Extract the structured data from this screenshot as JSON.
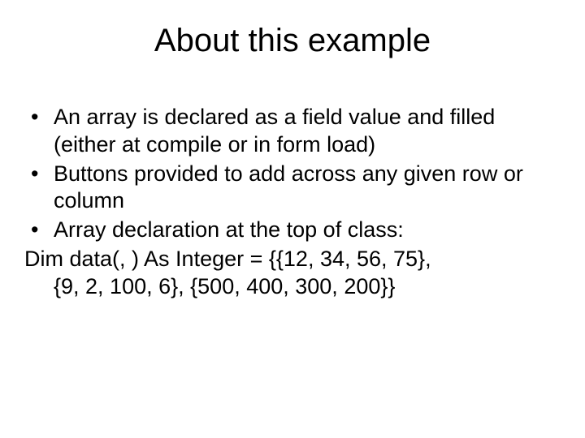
{
  "title": "About this example",
  "bullets": [
    "An array is declared as a field value and filled (either at compile or in form load)",
    "Buttons provided to add across any given row or column",
    "Array declaration at the top of class:"
  ],
  "code": {
    "line1": "Dim data(, ) As Integer = {{12, 34, 56, 75},",
    "line2": "{9, 2, 100, 6}, {500, 400, 300, 200}}"
  }
}
